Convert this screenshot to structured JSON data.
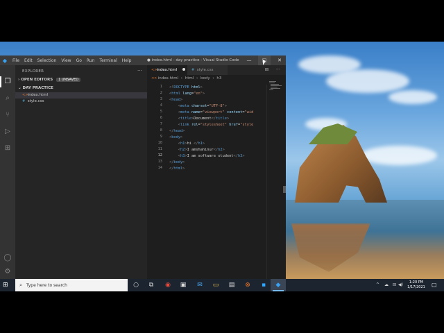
{
  "window": {
    "title": "● index.html - day practice - Visual Studio Code",
    "controls": {
      "min": "—",
      "max": "□",
      "close": "✕"
    }
  },
  "menu": [
    "File",
    "Edit",
    "Selection",
    "View",
    "Go",
    "Run",
    "Terminal",
    "Help"
  ],
  "sidebar": {
    "header": "EXPLORER",
    "more": "···",
    "open_editors": {
      "label": "OPEN EDITORS",
      "badge": "1 UNSAVED"
    },
    "folder": {
      "label": "DAY PRACTICE"
    },
    "files": [
      {
        "name": "index.html",
        "type": "html",
        "icon": "<>"
      },
      {
        "name": "style.css",
        "type": "css",
        "icon": "#"
      }
    ]
  },
  "editor": {
    "tabs": [
      {
        "label": "index.html",
        "icon": "<>",
        "dirty": true
      },
      {
        "label": "style.css",
        "icon": "#"
      }
    ],
    "breadcrumb": [
      "index.html",
      "html",
      "body",
      "h3"
    ],
    "lines": [
      {
        "n": "1",
        "html": "<span class=\"g\">&lt;!</span><span class=\"t\">DOCTYPE</span> <span class=\"a\">html</span><span class=\"g\">&gt;</span>"
      },
      {
        "n": "2",
        "html": "<span class=\"g\">&lt;</span><span class=\"t\">html</span> <span class=\"a\">lang</span>=<span class=\"s\">\"en\"</span><span class=\"g\">&gt;</span>"
      },
      {
        "n": "3",
        "html": "<span class=\"g\">&lt;</span><span class=\"t\">head</span><span class=\"g\">&gt;</span>"
      },
      {
        "n": "4",
        "html": "    <span class=\"g\">&lt;</span><span class=\"t\">meta</span> <span class=\"a\">charset</span>=<span class=\"s\">\"UTF-8\"</span><span class=\"g\">&gt;</span>"
      },
      {
        "n": "5",
        "html": "    <span class=\"g\">&lt;</span><span class=\"t\">meta</span> <span class=\"a\">name</span>=<span class=\"s\">\"viewport\"</span> <span class=\"a\">content</span>=<span class=\"s\">\"wid</span>"
      },
      {
        "n": "6",
        "html": "    <span class=\"g\">&lt;</span><span class=\"t\">title</span><span class=\"g\">&gt;</span>Document<span class=\"g\">&lt;/</span><span class=\"t\">title</span><span class=\"g\">&gt;</span>"
      },
      {
        "n": "7",
        "html": "    <span class=\"g\">&lt;</span><span class=\"t\">link</span> <span class=\"a\">rel</span>=<span class=\"s\">\"stylesheet\"</span> <span class=\"a\">href</span>=<span class=\"s\">\"style</span>"
      },
      {
        "n": "8",
        "html": "<span class=\"g\">&lt;/</span><span class=\"t\">head</span><span class=\"g\">&gt;</span>"
      },
      {
        "n": "9",
        "html": "<span class=\"g\">&lt;</span><span class=\"t\">body</span><span class=\"g\">&gt;</span>"
      },
      {
        "n": "10",
        "html": "    <span class=\"g\">&lt;</span><span class=\"t\">h1</span><span class=\"g\">&gt;</span>hi <span class=\"g\">&lt;/</span><span class=\"t\">h1</span><span class=\"g\">&gt;</span>"
      },
      {
        "n": "11",
        "html": "    <span class=\"g\">&lt;</span><span class=\"t\">h2</span><span class=\"g\">&gt;</span>I amshahinur<span class=\"g\">&lt;/</span><span class=\"t\">h2</span><span class=\"g\">&gt;</span>"
      },
      {
        "n": "12",
        "html": "    <span class=\"g\">&lt;</span><span class=\"t\">h3</span><span class=\"g\">&gt;</span>I am software student<span class=\"g\">&lt;/</span><span class=\"t\">h3</span><span class=\"g\">&gt;</span>",
        "current": true
      },
      {
        "n": "13",
        "html": "<span class=\"g\">&lt;/</span><span class=\"t\">body</span><span class=\"g\">&gt;</span>"
      },
      {
        "n": "14",
        "html": "<span class=\"g\">&lt;/</span><span class=\"t\">html</span><span class=\"g\">&gt;</span>"
      }
    ]
  },
  "taskbar": {
    "search_placeholder": "Type here to search",
    "time": "1:20 PM",
    "date": "1/17/2021",
    "tray_icons": [
      "^",
      "☁",
      "⊟",
      "◀)"
    ]
  },
  "colors": {
    "activity_bar": "#333333",
    "sidebar": "#252526",
    "editor_bg": "#1e1e1e",
    "title_bar": "#3c3c3c",
    "taskbar": "#1c2430",
    "accent": "#3aa0f0"
  }
}
